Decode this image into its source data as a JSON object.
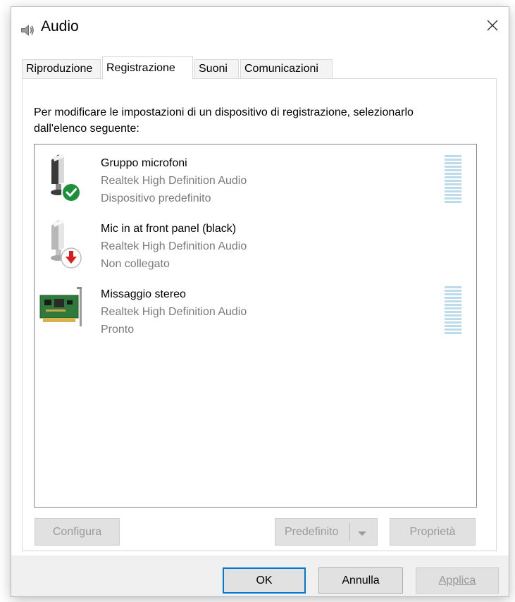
{
  "window": {
    "title": "Audio",
    "close_glyph": "✕",
    "icon": "speaker-icon"
  },
  "tabs": [
    {
      "label": "Riproduzione",
      "active": false
    },
    {
      "label": "Registrazione",
      "active": true
    },
    {
      "label": "Suoni",
      "active": false
    },
    {
      "label": "Comunicazioni",
      "active": false
    }
  ],
  "panel": {
    "instruction": "Per modificare le impostazioni di un dispositivo di registrazione, selezionarlo dall'elenco seguente:"
  },
  "devices": [
    {
      "name": "Gruppo microfoni",
      "driver": "Realtek High Definition Audio",
      "status": "Dispositivo predefinito",
      "icon": "microphone-icon",
      "badge": "default-check-badge-icon",
      "has_level_meter": true
    },
    {
      "name": "Mic in at front panel (black)",
      "driver": "Realtek High Definition Audio",
      "status": "Non collegato",
      "icon": "microphone-icon",
      "badge": "unplugged-arrow-badge-icon",
      "has_level_meter": false
    },
    {
      "name": "Missaggio stereo",
      "driver": "Realtek High Definition Audio",
      "status": "Pronto",
      "icon": "sound-card-icon",
      "badge": null,
      "has_level_meter": true
    }
  ],
  "buttons": {
    "configure": "Configura",
    "set_default": "Predefinito",
    "properties": "Proprietà"
  },
  "footer": {
    "ok": "OK",
    "cancel": "Annulla",
    "apply": "Applica"
  },
  "colors": {
    "accent": "#0078d7",
    "disabled_text": "#9a9a9a",
    "secondary_text": "#7a7a7a",
    "level_meter": "#bcdcec",
    "success_badge": "#1e8f3a",
    "unplugged_badge": "#d81e1e"
  }
}
